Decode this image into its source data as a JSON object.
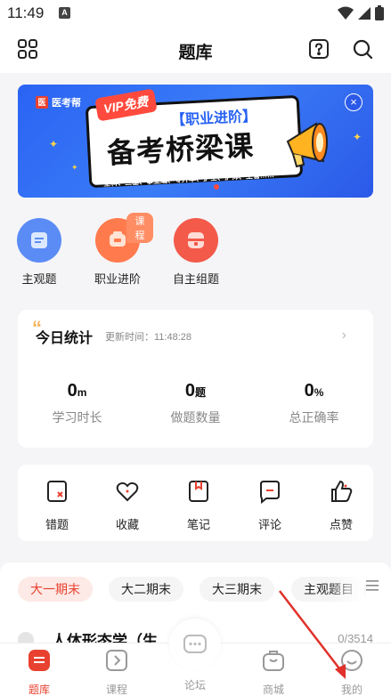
{
  "status": {
    "time": "11:49",
    "a_badge": "A"
  },
  "header": {
    "title": "题库"
  },
  "banner": {
    "logo": "医考帮",
    "vip": "VIP免费",
    "subtitle": "【职业进阶】",
    "main": "备考桥梁课",
    "tags": "全科、三基、事业编、专升本、护士、护师、主管……"
  },
  "quick_actions": [
    {
      "label": "主观题",
      "color": "#5b8cf5"
    },
    {
      "label": "职业进阶",
      "color": "#ff7b4d",
      "badge": "课程"
    },
    {
      "label": "自主组题",
      "color": "#f35a4a"
    }
  ],
  "stats": {
    "title": "今日统计",
    "updated": "更新时间：11:48:28",
    "items": [
      {
        "value": "0",
        "unit": "m",
        "label": "学习时长"
      },
      {
        "value": "0",
        "unit": "题",
        "label": "做题数量"
      },
      {
        "value": "0",
        "unit": "%",
        "label": "总正确率"
      }
    ]
  },
  "tools": [
    {
      "label": "错题",
      "icon": "wrong-question-icon"
    },
    {
      "label": "收藏",
      "icon": "heart-icon"
    },
    {
      "label": "笔记",
      "icon": "note-icon"
    },
    {
      "label": "评论",
      "icon": "comment-icon"
    },
    {
      "label": "点赞",
      "icon": "thumbs-up-icon"
    }
  ],
  "filters": [
    {
      "label": "大一期末",
      "active": true
    },
    {
      "label": "大二期末"
    },
    {
      "label": "大三期末"
    },
    {
      "label": "主观题目"
    }
  ],
  "list_peek": {
    "title": "人体形态学（生",
    "count": "0/3514"
  },
  "tabs": [
    {
      "label": "题库",
      "active": true
    },
    {
      "label": "课程"
    },
    {
      "label": "论坛"
    },
    {
      "label": "商城"
    },
    {
      "label": "我的"
    }
  ],
  "colors": {
    "accent": "#e8412f",
    "banner_blue": "#2a63f3",
    "annotation_arrow": "#e0322a"
  }
}
